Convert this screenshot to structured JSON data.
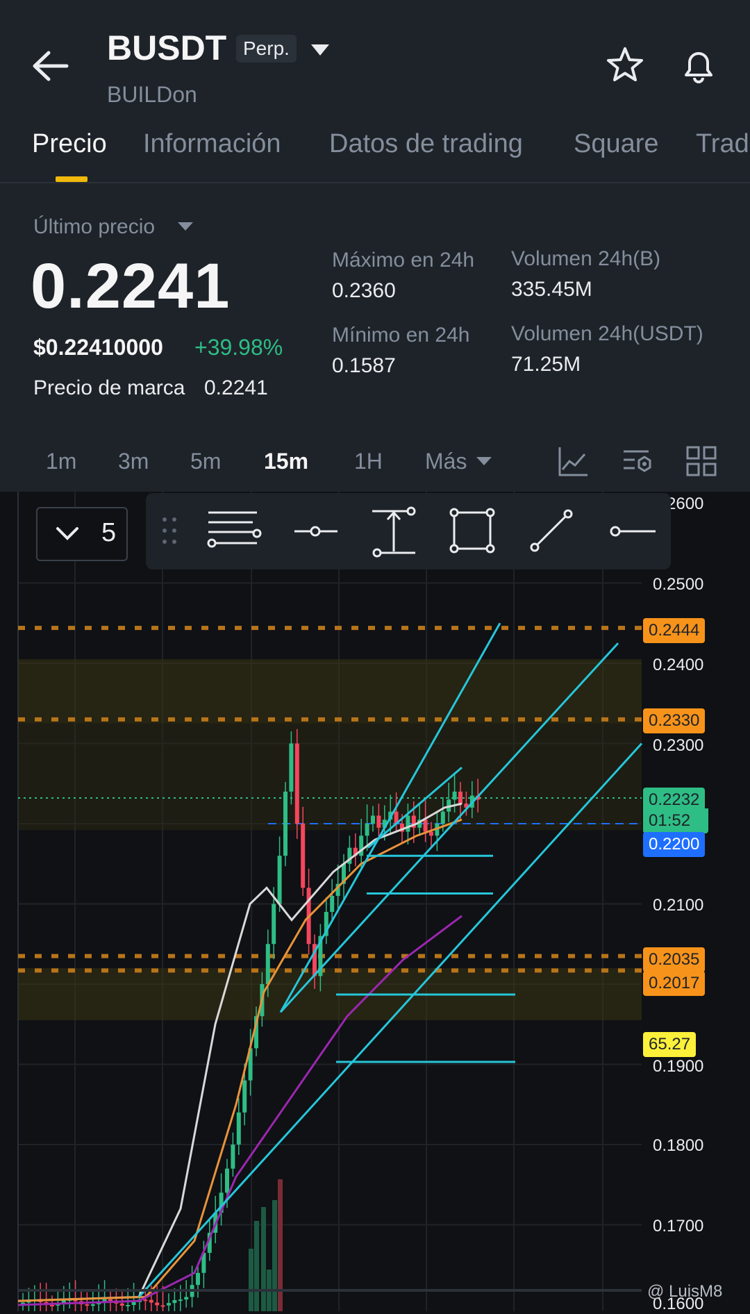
{
  "header": {
    "symbol": "BUSDT",
    "badge": "Perp.",
    "subtitle": "BUILDon",
    "icons": [
      "back-arrow-icon",
      "star-icon",
      "bell-icon"
    ]
  },
  "tabs": [
    {
      "label": "Precio",
      "active": true
    },
    {
      "label": "Información",
      "active": false
    },
    {
      "label": "Datos de trading",
      "active": false
    },
    {
      "label": "Square",
      "active": false
    },
    {
      "label": "Trad",
      "active": false
    }
  ],
  "price": {
    "label": "Último precio",
    "value": "0.2241",
    "usd": "$0.22410000",
    "change": "+39.98%",
    "mark_label": "Precio de marca",
    "mark_value": "0.2241"
  },
  "stats": {
    "high_label": "Máximo en 24h",
    "high_value": "0.2360",
    "low_label": "Mínimo en 24h",
    "low_value": "0.1587",
    "vol_b_label": "Volumen 24h(B)",
    "vol_b_value": "335.45M",
    "vol_usdt_label": "Volumen 24h(USDT)",
    "vol_usdt_value": "71.25M"
  },
  "timeframes": [
    {
      "label": "1m",
      "active": false
    },
    {
      "label": "3m",
      "active": false
    },
    {
      "label": "5m",
      "active": false
    },
    {
      "label": "15m",
      "active": true
    },
    {
      "label": "1H",
      "active": false
    },
    {
      "label": "Más",
      "active": false
    }
  ],
  "chart_tools": [
    "indicator-icon",
    "settings-icon",
    "layout-grid-icon"
  ],
  "drawing_toolbar": {
    "count": "5",
    "tools": [
      "drag-handle-icon",
      "fib-levels-icon",
      "horizontal-ray-icon",
      "measure-icon",
      "rectangle-icon",
      "trend-line-icon",
      "ray-icon"
    ]
  },
  "chart_data": {
    "type": "candlestick",
    "y_axis_labels": [
      "0.2600",
      "0.2500",
      "0.2400",
      "0.2300",
      "0.2100",
      "0.1900",
      "0.1800",
      "0.1700",
      "0.1600"
    ],
    "ylim": [
      0.16,
      0.26
    ],
    "price_tags": [
      {
        "text": "0.2444",
        "kind": "orange"
      },
      {
        "text": "0.2330",
        "kind": "orange"
      },
      {
        "text": "0.2232",
        "kind": "green"
      },
      {
        "text": "01:52",
        "kind": "green"
      },
      {
        "text": "0.2200",
        "kind": "blue"
      },
      {
        "text": "0.2035",
        "kind": "orange"
      },
      {
        "text": "0.2017",
        "kind": "orange"
      },
      {
        "text": "65.27",
        "kind": "yellow"
      }
    ],
    "colors": {
      "up": "#2ebd85",
      "down": "#f6465d",
      "line": "#26c6da",
      "ma_white": "#d9d9d9",
      "ma_orange": "#e8933b",
      "ma_purple": "#9c27b0"
    },
    "watermark": "@ LuisM8"
  }
}
